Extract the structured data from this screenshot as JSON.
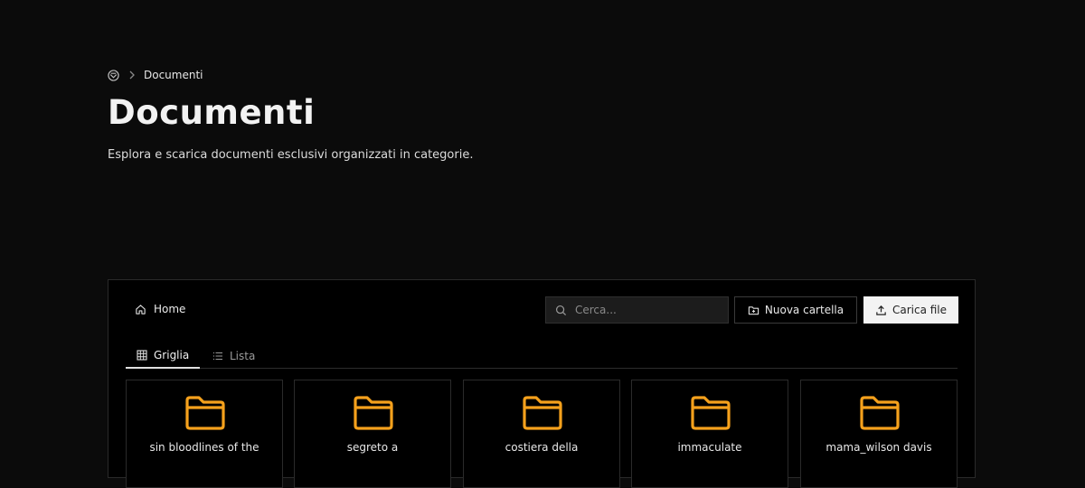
{
  "breadcrumb": {
    "current": "Documenti"
  },
  "page": {
    "title": "Documenti",
    "subtitle": "Esplora e scarica documenti esclusivi organizzati in categorie."
  },
  "toolbar": {
    "home_label": "Home",
    "search_placeholder": "Cerca...",
    "new_folder_label": "Nuova cartella",
    "upload_label": "Carica file"
  },
  "view_tabs": [
    {
      "label": "Griglia",
      "active": true
    },
    {
      "label": "Lista",
      "active": false
    }
  ],
  "folders": [
    {
      "name": "sin bloodlines of the"
    },
    {
      "name": "segreto a"
    },
    {
      "name": "costiera della"
    },
    {
      "name": "immaculate"
    },
    {
      "name": "mama_wilson davis"
    }
  ],
  "colors": {
    "accent": "#f5a11c",
    "background": "#0b0b0b",
    "panel": "#000000"
  }
}
